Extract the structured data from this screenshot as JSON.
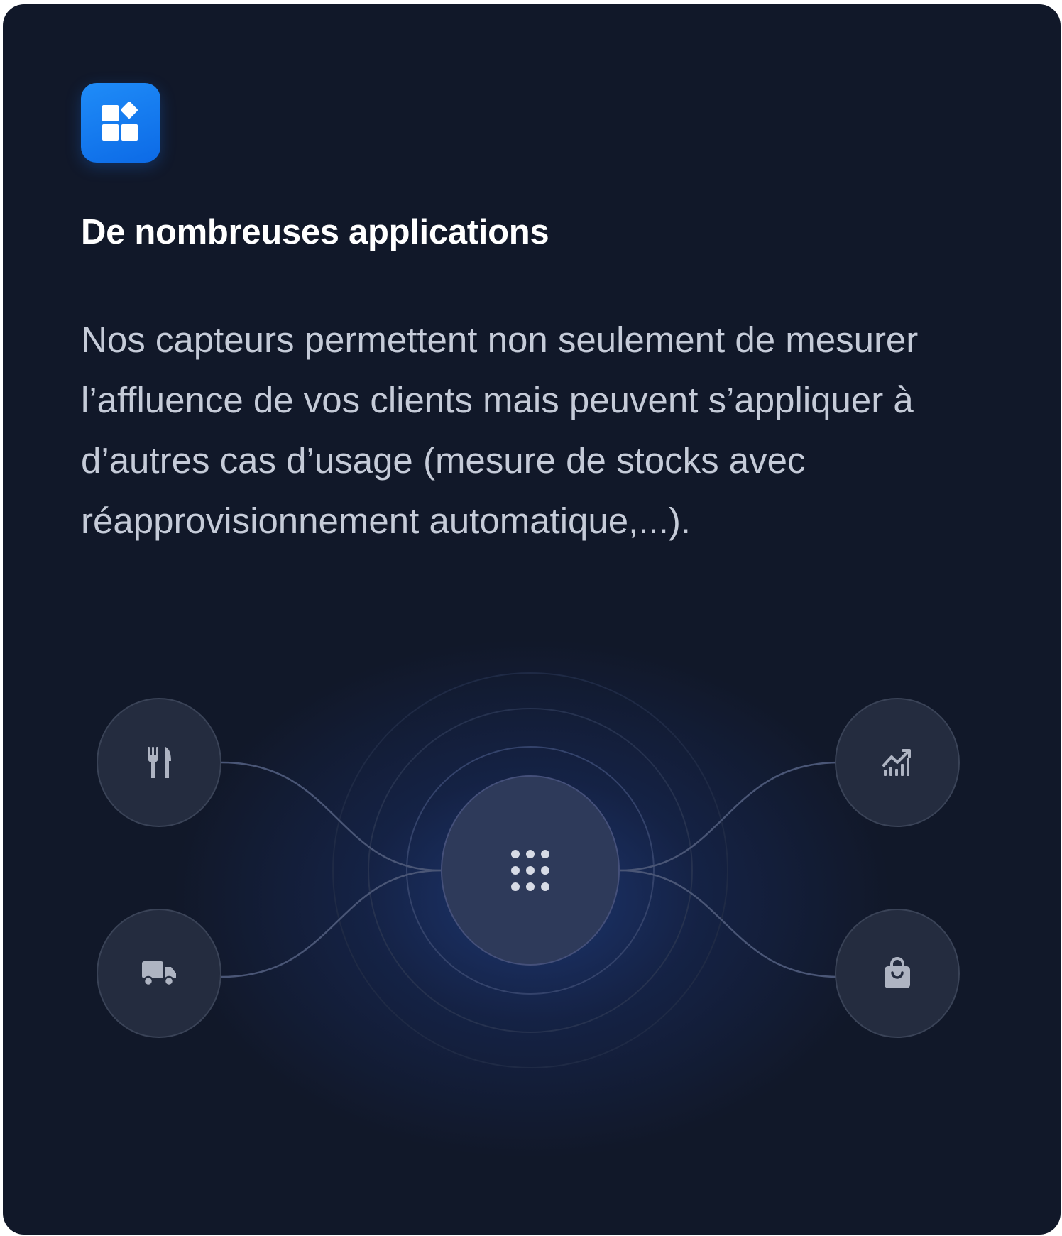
{
  "card": {
    "app_icon": "widgets-icon",
    "title": "De nombreuses applications",
    "description": "Nos capteurs permettent non seulement de mesurer l’affluence de vos clients mais peuvent s’appliquer à d’autres cas d’usage (mesure de stocks avec réapprovisionnement automatique,...)."
  },
  "diagram": {
    "hub_icon": "grid-dots-icon",
    "nodes": [
      {
        "icon": "fork-knife-icon"
      },
      {
        "icon": "truck-icon"
      },
      {
        "icon": "chart-icon"
      },
      {
        "icon": "shopping-bag-icon"
      }
    ]
  },
  "colors": {
    "background": "#111829",
    "accent": "#1b7ff2",
    "title": "#ffffff",
    "text": "#c5cbd8"
  }
}
